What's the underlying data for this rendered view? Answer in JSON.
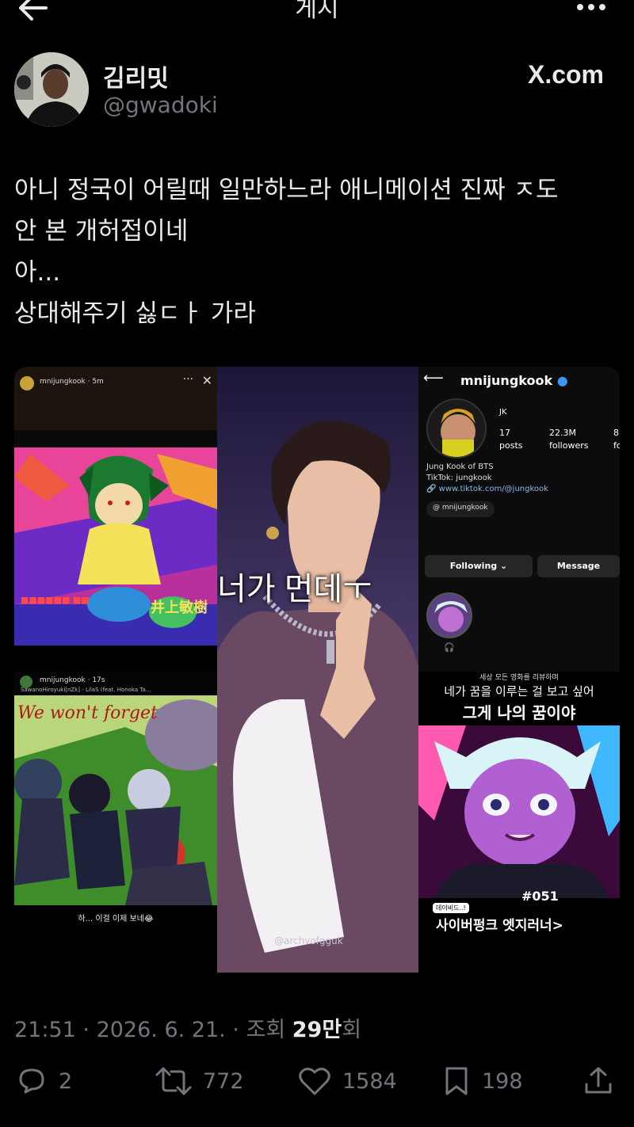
{
  "header": {
    "title": "게시"
  },
  "author": {
    "name": "김리밋",
    "handle": "@gwadoki",
    "source": "X.com"
  },
  "tweet": {
    "lines": [
      "아니 정국이 어릴때 일만하느라 애니메이션 진짜 ㅈ도",
      "안 본 개허접이네",
      "아...",
      "상대해주기 싫ㄷㅏ 가라"
    ]
  },
  "media": {
    "story1": {
      "user": "mnijungkook",
      "time": "5m",
      "caption_left": "井上敏樹"
    },
    "story2": {
      "user": "mnijungkook",
      "time": "17s",
      "music": "SawanoHiroyuki[nZk] - LilaS (feat. Honoka Ta...",
      "script_text": "We won't forget",
      "caption": "하... 이걸 이제 보네😂"
    },
    "center": {
      "overlay": "너가 먼데ㅜ",
      "watermark": "@archvofgguk"
    },
    "profile": {
      "username": "mnijungkook",
      "name": "JK",
      "posts": "17",
      "posts_label": "posts",
      "followers": "22.3M",
      "followers_label": "followers",
      "following_partial": "8",
      "following_label_partial": "fo",
      "bio1": "Jung Kook of BTS",
      "bio2": "TikTok: jungkook",
      "link": "www.tiktok.com/@jungkook",
      "threads": "mnijungkook",
      "follow_btn": "Following",
      "message_btn": "Message"
    },
    "review": {
      "small": "세상 모든 영화를 리뷰하며",
      "line1": "네가 꿈을 이루는 걸 보고 싶어",
      "line2": "그게 나의 꿈이야",
      "number": "#051",
      "tag": "데이비드..!",
      "title": "사이버펑크 엣지러너>"
    }
  },
  "meta": {
    "time": "21:51",
    "date": "2026. 6. 21.",
    "views_label": "조회",
    "views_num": "29만",
    "views_unit": "회"
  },
  "actions": {
    "replies": "2",
    "retweets": "772",
    "likes": "1584",
    "bookmarks": "198"
  }
}
